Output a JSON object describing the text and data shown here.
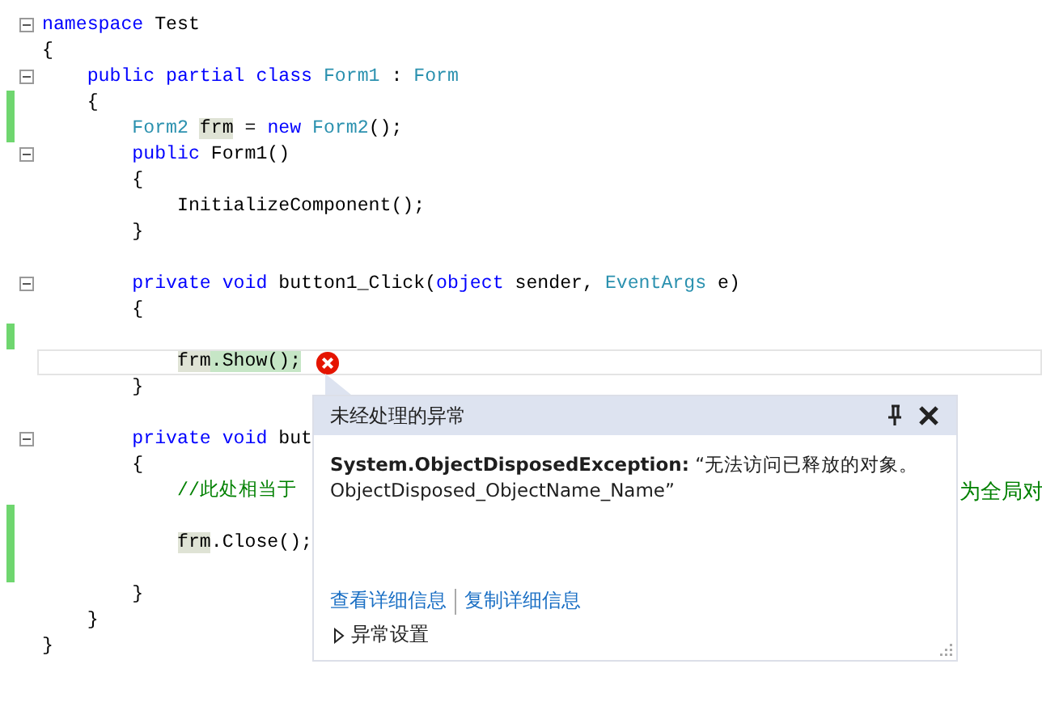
{
  "editor": {
    "lines": [
      {
        "foldable": true,
        "changed": false,
        "current": false,
        "error": false,
        "tokens": [
          {
            "kind": "keyword",
            "text": "namespace"
          },
          {
            "kind": "plain",
            "text": " Test"
          }
        ]
      },
      {
        "foldable": false,
        "changed": false,
        "current": false,
        "error": false,
        "tokens": [
          {
            "kind": "plain",
            "text": "{"
          }
        ]
      },
      {
        "foldable": true,
        "changed": false,
        "current": false,
        "error": false,
        "tokens": [
          {
            "kind": "keyword",
            "text": "    public partial class "
          },
          {
            "kind": "type",
            "text": "Form1"
          },
          {
            "kind": "plain",
            "text": " : "
          },
          {
            "kind": "type",
            "text": "Form"
          }
        ]
      },
      {
        "foldable": false,
        "changed": true,
        "current": false,
        "error": false,
        "tokens": [
          {
            "kind": "plain",
            "text": "    {"
          }
        ]
      },
      {
        "foldable": false,
        "changed": true,
        "current": false,
        "error": false,
        "tokens": [
          {
            "kind": "type",
            "text": "        Form2 "
          },
          {
            "kind": "reference",
            "text": "frm"
          },
          {
            "kind": "plain",
            "text": " = "
          },
          {
            "kind": "keyword",
            "text": "new "
          },
          {
            "kind": "type",
            "text": "Form2"
          },
          {
            "kind": "plain",
            "text": "();"
          }
        ]
      },
      {
        "foldable": true,
        "changed": false,
        "current": false,
        "error": false,
        "tokens": [
          {
            "kind": "keyword",
            "text": "        public"
          },
          {
            "kind": "plain",
            "text": " Form1()"
          }
        ]
      },
      {
        "foldable": false,
        "changed": false,
        "current": false,
        "error": false,
        "tokens": [
          {
            "kind": "plain",
            "text": "        {"
          }
        ]
      },
      {
        "foldable": false,
        "changed": false,
        "current": false,
        "error": false,
        "tokens": [
          {
            "kind": "plain",
            "text": "            InitializeComponent();"
          }
        ]
      },
      {
        "foldable": false,
        "changed": false,
        "current": false,
        "error": false,
        "tokens": [
          {
            "kind": "plain",
            "text": "        }"
          }
        ]
      },
      {
        "foldable": false,
        "changed": false,
        "current": false,
        "error": false
      },
      {
        "foldable": true,
        "changed": false,
        "current": false,
        "error": false,
        "tokens": [
          {
            "kind": "keyword",
            "text": "        private void"
          },
          {
            "kind": "plain",
            "text": " button1_Click("
          },
          {
            "kind": "keyword",
            "text": "object"
          },
          {
            "kind": "plain",
            "text": " sender, "
          },
          {
            "kind": "type",
            "text": "EventArgs"
          },
          {
            "kind": "plain",
            "text": " e)"
          }
        ]
      },
      {
        "foldable": false,
        "changed": false,
        "current": false,
        "error": false,
        "tokens": [
          {
            "kind": "plain",
            "text": "        {"
          }
        ]
      },
      {
        "foldable": false,
        "changed": true,
        "current": false,
        "error": false
      },
      {
        "foldable": false,
        "changed": false,
        "current": true,
        "error": true,
        "tokens": [
          {
            "kind": "reference",
            "text": "            frm"
          },
          {
            "kind": "statement",
            "text": ".Show();"
          }
        ]
      },
      {
        "foldable": false,
        "changed": false,
        "current": false,
        "error": false,
        "tokens": [
          {
            "kind": "plain",
            "text": "        }"
          }
        ]
      },
      {
        "foldable": false,
        "changed": false,
        "current": false,
        "error": false
      },
      {
        "foldable": true,
        "changed": false,
        "current": false,
        "error": false,
        "tokens": [
          {
            "kind": "keyword",
            "text": "        private void"
          },
          {
            "kind": "plain",
            "text": " but"
          }
        ]
      },
      {
        "foldable": false,
        "changed": false,
        "current": false,
        "error": false,
        "tokens": [
          {
            "kind": "plain",
            "text": "        {"
          }
        ]
      },
      {
        "foldable": false,
        "changed": false,
        "current": false,
        "error": false,
        "tokens": [
          {
            "kind": "comment",
            "text": "            //此处相当于"
          }
        ],
        "tail": "为全局对"
      },
      {
        "foldable": false,
        "changed": true,
        "current": false,
        "error": false
      },
      {
        "foldable": false,
        "changed": true,
        "current": false,
        "error": false,
        "tokens": [
          {
            "kind": "reference",
            "text": "            frm"
          },
          {
            "kind": "plain",
            "text": ".Close();"
          }
        ]
      },
      {
        "foldable": false,
        "changed": true,
        "current": false,
        "error": false
      },
      {
        "foldable": false,
        "changed": false,
        "current": false,
        "error": false,
        "tokens": [
          {
            "kind": "plain",
            "text": "        }"
          }
        ]
      },
      {
        "foldable": false,
        "changed": false,
        "current": false,
        "error": false,
        "tokens": [
          {
            "kind": "plain",
            "text": "    }"
          }
        ]
      },
      {
        "foldable": false,
        "changed": false,
        "current": false,
        "error": false,
        "tokens": [
          {
            "kind": "plain",
            "text": "}"
          }
        ]
      }
    ]
  },
  "exception_popup": {
    "title": "未经处理的异常",
    "message": "**System.ObjectDisposedException:** “无法访问已释放的对象。\nObjectDisposed_ObjectName_Name”",
    "links": [
      "查看详细信息",
      "复制详细信息"
    ],
    "settings": {
      "label": "异常设置",
      "expanded": false
    }
  }
}
